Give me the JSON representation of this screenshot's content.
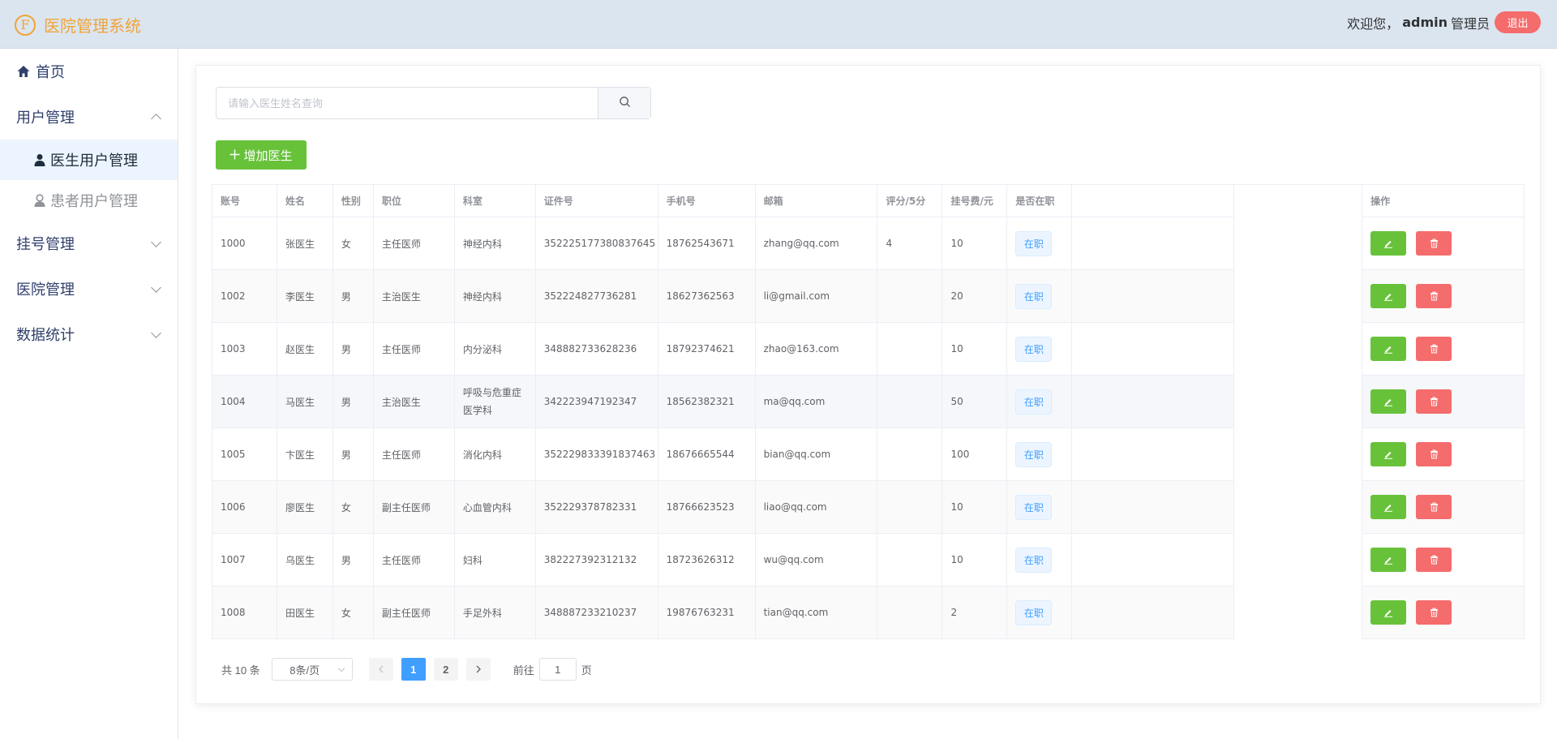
{
  "header": {
    "app_title": "医院管理系统",
    "logo_letter": "F",
    "welcome_prefix": "欢迎您，",
    "username": "admin",
    "role": "管理员",
    "logout_label": "退出"
  },
  "sidebar": {
    "home": "首页",
    "user_mgmt": "用户管理",
    "doctor_users": "医生用户管理",
    "patient_users": "患者用户管理",
    "registration_mgmt": "挂号管理",
    "hospital_mgmt": "医院管理",
    "data_stats": "数据统计"
  },
  "search": {
    "placeholder": "请输入医生姓名查询"
  },
  "toolbar": {
    "add_label": "增加医生"
  },
  "table": {
    "headers": [
      "账号",
      "姓名",
      "性别",
      "职位",
      "科室",
      "证件号",
      "手机号",
      "邮箱",
      "评分/5分",
      "挂号费/元",
      "是否在职",
      "",
      "",
      "操作"
    ],
    "rows": [
      {
        "id": "1000",
        "name": "张医生",
        "gender": "女",
        "title": "主任医师",
        "dept": "神经内科",
        "card": "352225177380837645",
        "phone": "18762543671",
        "email": "zhang@qq.com",
        "score": "4",
        "fee": "10",
        "status": "在职"
      },
      {
        "id": "1002",
        "name": "李医生",
        "gender": "男",
        "title": "主治医生",
        "dept": "神经内科",
        "card": "352224827736281",
        "phone": "18627362563",
        "email": "li@gmail.com",
        "score": "",
        "fee": "20",
        "status": "在职"
      },
      {
        "id": "1003",
        "name": "赵医生",
        "gender": "男",
        "title": "主任医师",
        "dept": "内分泌科",
        "card": "348882733628236",
        "phone": "18792374621",
        "email": "zhao@163.com",
        "score": "",
        "fee": "10",
        "status": "在职"
      },
      {
        "id": "1004",
        "name": "马医生",
        "gender": "男",
        "title": "主治医生",
        "dept": "呼吸与危重症医学科",
        "card": "342223947192347",
        "phone": "18562382321",
        "email": "ma@qq.com",
        "score": "",
        "fee": "50",
        "status": "在职"
      },
      {
        "id": "1005",
        "name": "卞医生",
        "gender": "男",
        "title": "主任医师",
        "dept": "消化内科",
        "card": "352229833391837463",
        "phone": "18676665544",
        "email": "bian@qq.com",
        "score": "",
        "fee": "100",
        "status": "在职"
      },
      {
        "id": "1006",
        "name": "廖医生",
        "gender": "女",
        "title": "副主任医师",
        "dept": "心血管内科",
        "card": "352229378782331",
        "phone": "18766623523",
        "email": "liao@qq.com",
        "score": "",
        "fee": "10",
        "status": "在职"
      },
      {
        "id": "1007",
        "name": "乌医生",
        "gender": "男",
        "title": "主任医师",
        "dept": "妇科",
        "card": "382227392312132",
        "phone": "18723626312",
        "email": "wu@qq.com",
        "score": "",
        "fee": "10",
        "status": "在职"
      },
      {
        "id": "1008",
        "name": "田医生",
        "gender": "女",
        "title": "副主任医师",
        "dept": "手足外科",
        "card": "348887233210237",
        "phone": "19876763231",
        "email": "tian@qq.com",
        "score": "",
        "fee": "2",
        "status": "在职"
      }
    ]
  },
  "pagination": {
    "total": "共 10 条",
    "page_size": "8条/页",
    "pages": [
      "1",
      "2"
    ],
    "current": "1",
    "goto_prefix": "前往",
    "goto_value": "1",
    "goto_suffix": "页"
  },
  "colors": {
    "primary": "#409eff",
    "success": "#67c23a",
    "danger": "#f56c6c",
    "brand": "#f0a43a",
    "header_bg": "#dbe5ef"
  }
}
